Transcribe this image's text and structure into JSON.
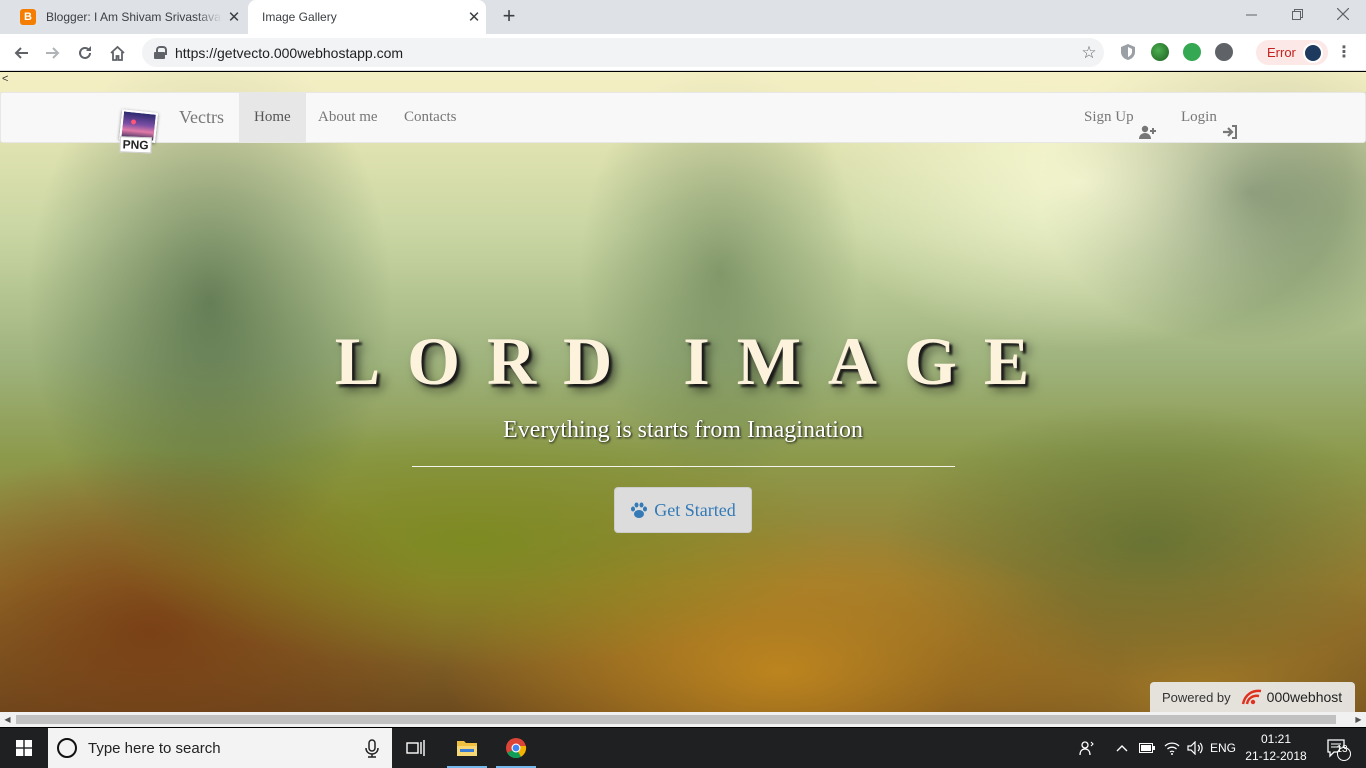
{
  "browser": {
    "tabs": [
      {
        "title": "Blogger: I Am Shivam Srivastava",
        "favicon": "blogger-icon",
        "favicon_letter": "B",
        "active": false
      },
      {
        "title": "Image Gallery",
        "favicon": "page-icon",
        "active": true
      }
    ],
    "new_tab_symbol": "+",
    "url": "https://getvecto.000webhostapp.com",
    "error_label": "Error"
  },
  "page": {
    "corner_glyph": "<",
    "navbar": {
      "logo_text": "PNG",
      "brand": "Vectrs",
      "items": [
        {
          "label": "Home",
          "active": true
        },
        {
          "label": "About me",
          "active": false
        },
        {
          "label": "Contacts",
          "active": false
        }
      ],
      "signup_label": "Sign Up",
      "login_label": "Login"
    },
    "hero": {
      "title": "LORD IMAGE",
      "subtitle": "Everything is starts from Imagination",
      "cta_label": "Get Started"
    },
    "powered": {
      "prefix": "Powered by",
      "brand": "000webhost"
    }
  },
  "taskbar": {
    "search_placeholder": "Type here to search",
    "language": "ENG",
    "time": "01:21",
    "date": "21-12-2018",
    "notification_count": "13"
  },
  "colors": {
    "link_blue": "#337ab7",
    "navbar_bg": "#f8f8f8",
    "taskbar_bg": "#1f2022",
    "error_red": "#c5221f"
  }
}
